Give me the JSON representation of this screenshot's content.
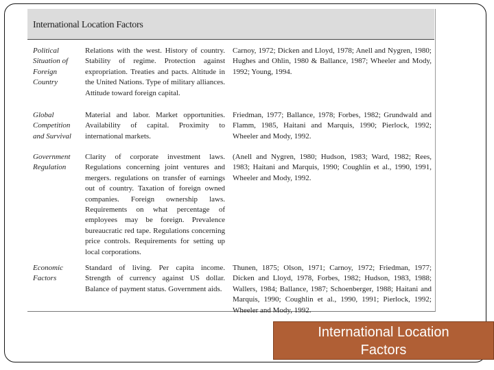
{
  "table": {
    "title": "International Location Factors",
    "rows": [
      {
        "factor": "Political Situation of Foreign Country",
        "description": "Relations with the west. History of country. Stability of regime. Protection against expropriation. Treaties and pacts. Altitude in the United Nations. Type of military alliances. Attitude toward foreign capital.",
        "citations": "Carnoy, 1972; Dicken and Lloyd, 1978; Anell and Nygren, 1980; Hughes and Ohlin, 1980 & Ballance, 1987; Wheeler and Mody, 1992; Young, 1994."
      },
      {
        "factor": "Global Competition and Survival",
        "description": "Material and labor. Market opportunities. Availability of capital. Proximity to international markets.",
        "citations": "Friedman, 1977; Ballance, 1978; Forbes, 1982; Grundwald and Flamm, 1985, Haitani and Marquis, 1990; Pierlock, 1992; Wheeler and Mody, 1992."
      },
      {
        "factor": "Government Regulation",
        "description": "Clarity of corporate investment laws. Regulations concerning joint ventures and mergers. regulations on transfer of earnings out of country. Taxation of foreign owned companies. Foreign ownership laws. Requirements on what percentage of employees may be foreign. Prevalence bureaucratic red tape. Regulations concerning price controls. Requirements for setting up local corporations.",
        "citations": "(Anell and Nygren, 1980; Hudson, 1983; Ward, 1982; Rees, 1983; Haitani and Marquis, 1990; Coughlin et al., 1990, 1991, Wheeler and Mody, 1992."
      },
      {
        "factor": "Economic Factors",
        "description": "Standard of living. Per capita income. Strength of currency against US dollar. Balance of payment status. Government aids.",
        "citations": "Thunen, 1875; Olson, 1971; Carnoy, 1972; Friedman, 1977; Dicken and Lloyd, 1978, Forbes, 1982; Hudson, 1983, 1988; Wallers, 1984; Ballance, 1987; Schoenberger, 1988; Haitani and Marquis, 1990; Coughlin et al., 1990, 1991; Pierlock, 1992; Wheeler and Mody, 1992."
      }
    ]
  },
  "caption": {
    "line1": "International Location",
    "line2": "Factors",
    "background": "#b05f35"
  }
}
